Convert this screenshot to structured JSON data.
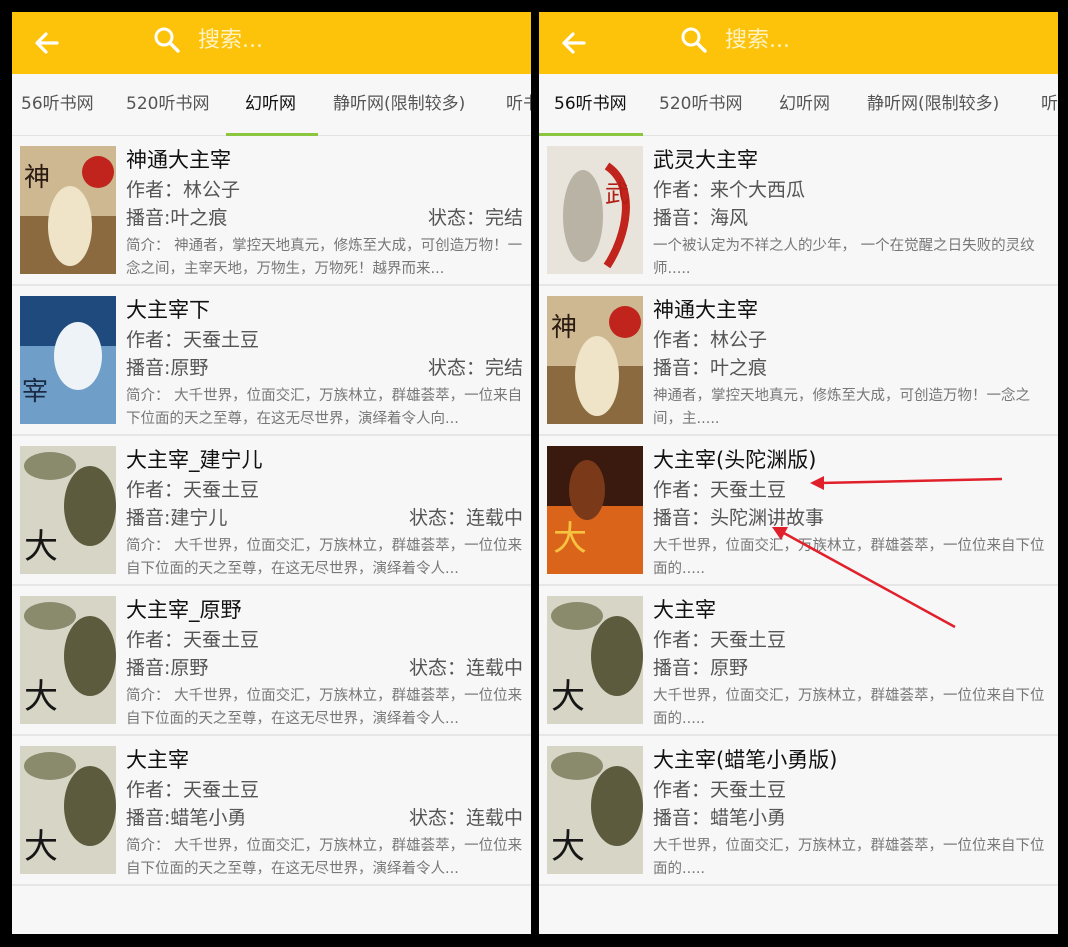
{
  "colors": {
    "topbar": "#fcc30a",
    "tab_indicator": "#8cc63f",
    "annotation_arrow": "#e0202a"
  },
  "left": {
    "search": {
      "placeholder": "搜索..."
    },
    "tabs": [
      "56听书网",
      "520听书网",
      "幻听网",
      "静听网(限制较多)",
      "听书"
    ],
    "active_tab": "幻听网",
    "books": [
      {
        "title": "神通大主宰",
        "author": "作者：林公子",
        "narrator": "播音:叶之痕",
        "status": "状态：完结",
        "intro": "简介：  神通者，掌控天地真元，修炼至大成，可创造万物！一念之间，主宰天地，万物生，万物死！越界而来..."
      },
      {
        "title": "大主宰下",
        "author": "作者：天蚕土豆",
        "narrator": "播音:原野",
        "status": "状态：完结",
        "intro": "简介：  大千世界，位面交汇，万族林立，群雄荟萃，一位来自下位面的天之至尊，在这无尽世界，演绎着令人向..."
      },
      {
        "title": "大主宰_建宁儿",
        "author": "作者：天蚕土豆",
        "narrator": "播音:建宁儿",
        "status": "状态：连载中",
        "intro": "简介：  大千世界，位面交汇，万族林立，群雄荟萃，一位位来自下位面的天之至尊，在这无尽世界，演绎着令人..."
      },
      {
        "title": "大主宰_原野",
        "author": "作者：天蚕土豆",
        "narrator": "播音:原野",
        "status": "状态：连载中",
        "intro": "简介：  大千世界，位面交汇，万族林立，群雄荟萃，一位位来自下位面的天之至尊，在这无尽世界，演绎着令人..."
      },
      {
        "title": "大主宰",
        "author": "作者：天蚕土豆",
        "narrator": "播音:蜡笔小勇",
        "status": "状态：连载中",
        "intro": "简介：  大千世界，位面交汇，万族林立，群雄荟萃，一位位来自下位面的天之至尊，在这无尽世界，演绎着令人..."
      }
    ]
  },
  "right": {
    "search": {
      "placeholder": "搜索..."
    },
    "tabs": [
      "56听书网",
      "520听书网",
      "幻听网",
      "静听网(限制较多)",
      "听"
    ],
    "active_tab": "56听书网",
    "books": [
      {
        "title": "武灵大主宰",
        "author": "作者：来个大西瓜",
        "narrator": "播音：海风",
        "intro": "一个被认定为不祥之人的少年，  一个在觉醒之日失败的灵纹师....."
      },
      {
        "title": "神通大主宰",
        "author": "作者：林公子",
        "narrator": "播音：叶之痕",
        "intro": "神通者，掌控天地真元，修炼至大成，可创造万物！一念之间，主....."
      },
      {
        "title": "大主宰(头陀渊版)",
        "author": "作者：天蚕土豆",
        "narrator": "播音：头陀渊讲故事",
        "intro": "大千世界，位面交汇，万族林立，群雄荟萃，一位位来自下位面的....."
      },
      {
        "title": "大主宰",
        "author": "作者：天蚕土豆",
        "narrator": "播音：原野",
        "intro": "大千世界，位面交汇，万族林立，群雄荟萃，一位位来自下位面的....."
      },
      {
        "title": "大主宰(蜡笔小勇版)",
        "author": "作者：天蚕土豆",
        "narrator": "播音：蜡笔小勇",
        "intro": "大千世界，位面交汇，万族林立，群雄荟萃，一位位来自下位面的....."
      }
    ]
  }
}
